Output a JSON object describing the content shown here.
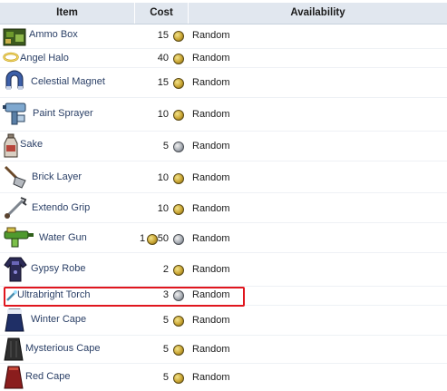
{
  "table": {
    "headers": {
      "item": "Item",
      "cost": "Cost",
      "availability": "Availability"
    },
    "rows": [
      {
        "name": "Ammo Box",
        "cost": "15",
        "coin": "gold",
        "availability": "Random",
        "icon": "ammo-box-icon"
      },
      {
        "name": "Angel Halo",
        "cost": "40",
        "coin": "gold",
        "availability": "Random",
        "icon": "angel-halo-icon"
      },
      {
        "name": "Celestial Magnet",
        "cost": "15",
        "coin": "gold",
        "availability": "Random",
        "icon": "celestial-magnet-icon"
      },
      {
        "name": "Paint Sprayer",
        "cost": "10",
        "coin": "gold",
        "availability": "Random",
        "icon": "paint-sprayer-icon"
      },
      {
        "name": "Sake",
        "cost": "5",
        "coin": "silver",
        "availability": "Random",
        "icon": "sake-icon"
      },
      {
        "name": "Brick Layer",
        "cost": "10",
        "coin": "gold",
        "availability": "Random",
        "icon": "brick-layer-icon"
      },
      {
        "name": "Extendo Grip",
        "cost": "10",
        "coin": "gold",
        "availability": "Random",
        "icon": "extendo-grip-icon"
      },
      {
        "name": "Water Gun",
        "cost_platinum": "1",
        "cost": "50",
        "coin": "silver",
        "availability": "Random",
        "icon": "water-gun-icon"
      },
      {
        "name": "Gypsy Robe",
        "cost": "2",
        "coin": "gold",
        "availability": "Random",
        "icon": "gypsy-robe-icon"
      },
      {
        "name": "Ultrabright Torch",
        "cost": "3",
        "coin": "silver",
        "availability": "Random",
        "icon": "ultrabright-torch-icon",
        "highlighted": true
      },
      {
        "name": "Winter Cape",
        "cost": "5",
        "coin": "gold",
        "availability": "Random",
        "icon": "winter-cape-icon"
      },
      {
        "name": "Mysterious Cape",
        "cost": "5",
        "coin": "gold",
        "availability": "Random",
        "icon": "mysterious-cape-icon"
      },
      {
        "name": "Red Cape",
        "cost": "5",
        "coin": "gold",
        "availability": "Random",
        "icon": "red-cape-icon"
      }
    ]
  },
  "colors": {
    "header_bg": "#e1e7ef",
    "link_text": "#2a3f66",
    "highlight_border": "#e0161e"
  }
}
